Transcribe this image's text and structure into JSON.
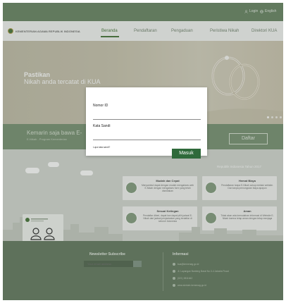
{
  "topbar": {
    "login": "Login",
    "language": "English"
  },
  "header": {
    "logo_text": "KEMENTERIAN AGAMA REPUBLIK INDONESIA",
    "nav": [
      "Beranda",
      "Pendaftaran",
      "Pengaduan",
      "Peristiwa Nikah",
      "Direktori KUA"
    ],
    "active_nav": "Beranda"
  },
  "hero": {
    "title_bold": "Pastikan",
    "title_rest": "Nikah anda tercatat di KUA",
    "slide_count": 4,
    "active_slide": 1
  },
  "band": {
    "title": "Kemarin saja bawa E-",
    "subtitle": "E-Nikah - Program Kementerian",
    "button": "Daftar"
  },
  "services": {
    "year_note": "Republik Indonesia Tahun 2017",
    "cards": [
      {
        "title": "Mudah dan Cepat",
        "text": "Menyambut dapat dengan mudah mengakses web E-Nikah dengan mengakses form yang telah disediakan"
      },
      {
        "title": "Hemat Biaya",
        "text": "Pendaftaran tanpa E-Nikah cukup melalui website. Dan tanpa pemungutan biaya apapun"
      },
      {
        "title": "Sesuai Ketingan",
        "text": "Pendaftar diberi, dapat kan dapat pilih jadwal E-Nikah dari jadwal penjadwalan yang terdaftar di seluruh Indonesia"
      },
      {
        "title": "Aman",
        "text": "Tidak akan ada kemudahan informasi di Website E-Nikah karena tetap aman dengan tetap menjaga"
      }
    ]
  },
  "footer": {
    "newsletter_title": "Newsletter Subscribe",
    "newsletter_placeholder": "Your email address",
    "info_title": "Informasi",
    "info": [
      "kua@kemenag.go.id",
      "Jl. Lapangan Banteng Barat No.3-4 Jakarta Pusat",
      "(021) 3811642",
      "www.simkah.kemenag.go.id"
    ]
  },
  "modal": {
    "nomor_label": "Nomor ID",
    "nomor_value": "",
    "password_label": "Kata Sandi",
    "password_value": "",
    "forgot": "Lupa kata sandi?",
    "submit": "Masuk"
  }
}
